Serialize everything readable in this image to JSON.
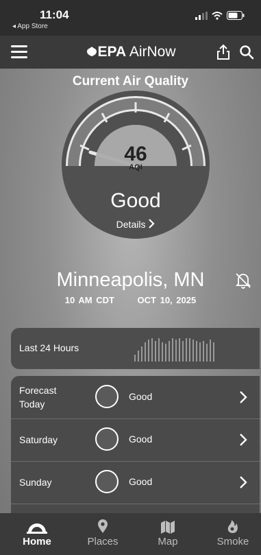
{
  "status_bar": {
    "time": "11:04",
    "back_label": "◂ App Store"
  },
  "header": {
    "brand_epa": "EPA",
    "brand_app": "AirNow",
    "share_icon": "share-icon",
    "search_icon": "search-icon",
    "menu_icon": "hamburger-menu-icon"
  },
  "current": {
    "title": "Current Air Quality",
    "aqi": "46",
    "aqi_label": "AQI",
    "category": "Good",
    "details_label": "Details",
    "gauge_fraction": 0.092
  },
  "location": {
    "city": "Minneapolis, MN",
    "time": "10 AM CDT",
    "date": "OCT 10, 2025",
    "notify_icon": "bell-off-icon"
  },
  "history": {
    "label": "Last 24 Hours"
  },
  "forecast": [
    {
      "label": "Forecast\nToday",
      "category": "Good"
    },
    {
      "label": "Saturday",
      "category": "Good"
    },
    {
      "label": "Sunday",
      "category": "Good"
    }
  ],
  "tabs": [
    {
      "label": "Home",
      "icon": "home-gauge-icon",
      "active": true
    },
    {
      "label": "Places",
      "icon": "location-pin-icon",
      "active": false
    },
    {
      "label": "Map",
      "icon": "map-icon",
      "active": false
    },
    {
      "label": "Smoke",
      "icon": "smoke-fire-icon",
      "active": false
    }
  ]
}
